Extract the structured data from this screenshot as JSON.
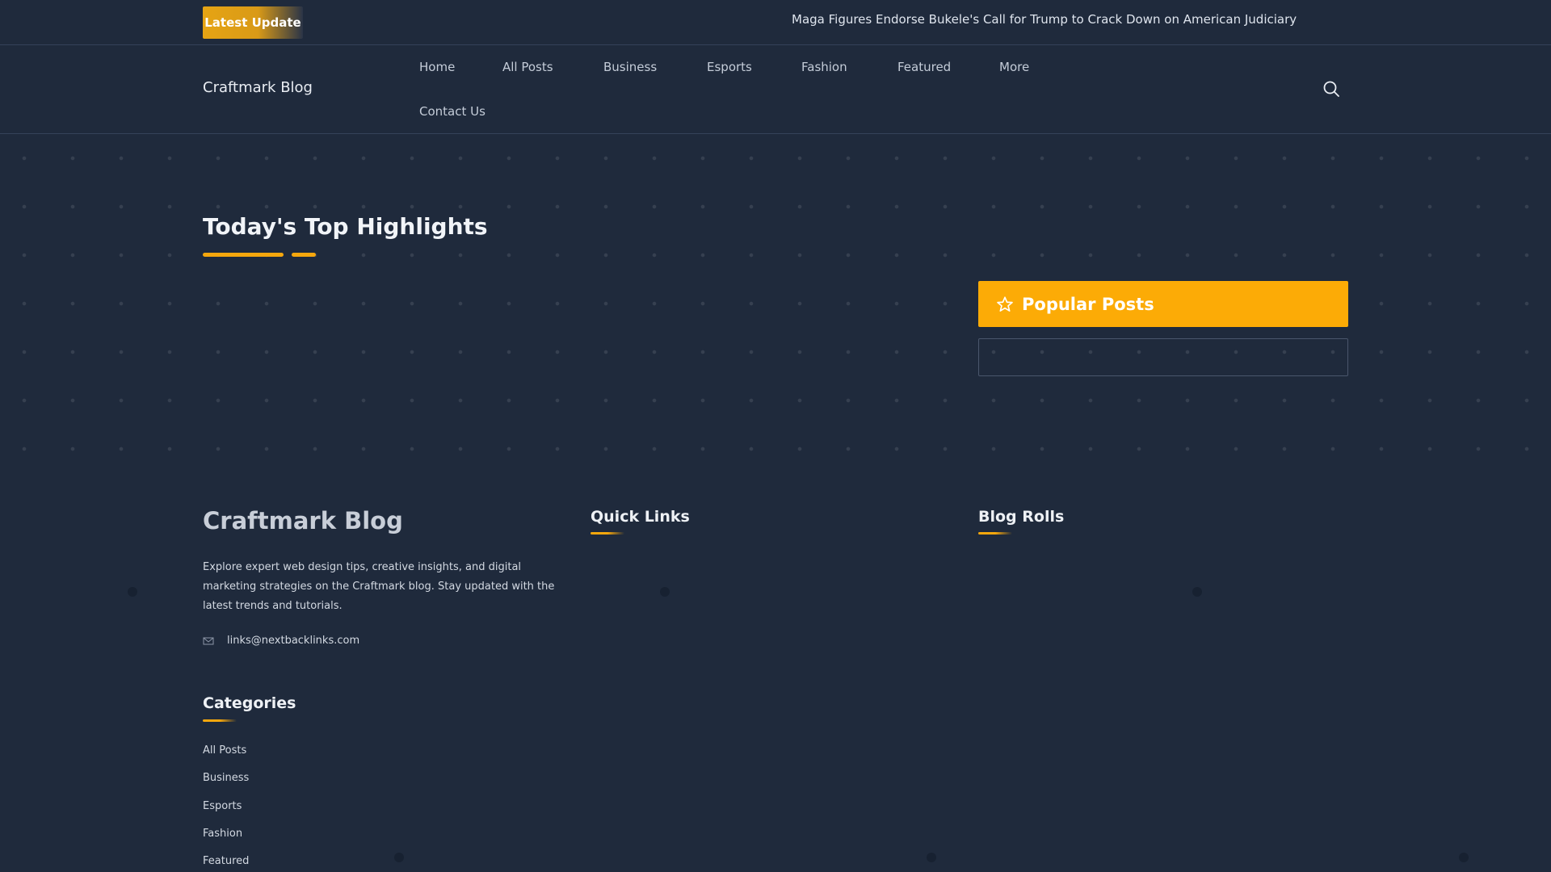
{
  "topbar": {
    "badge_word1": "Latest",
    "badge_word2": "Update",
    "ticker_headline": "Maga Figures Endorse Bukele's Call for Trump to Crack Down on American Judiciary"
  },
  "header": {
    "site_title": "Craftmark Blog",
    "nav": [
      "Home",
      "All Posts",
      "Business",
      "Esports",
      "Fashion",
      "Featured",
      "More",
      "Contact Us"
    ],
    "search_icon": "search-icon"
  },
  "main": {
    "highlights_title": "Today's Top Highlights",
    "popular_posts_title": "Popular Posts",
    "popular_icon": "star-outline-icon"
  },
  "footer": {
    "brand": "Craftmark Blog",
    "description": "Explore expert web design tips, creative insights, and digital marketing strategies on the Craftmark blog. Stay updated with the latest trends and tutorials.",
    "email": "links@nextbacklinks.com",
    "email_icon": "envelope-icon",
    "quick_links_title": "Quick Links",
    "blog_rolls_title": "Blog Rolls",
    "categories_title": "Categories",
    "categories": [
      "All Posts",
      "Business",
      "Esports",
      "Fashion",
      "Featured"
    ]
  },
  "colors": {
    "background": "#1f2a3c",
    "accent": "#fcab06",
    "border": "#35425a"
  }
}
